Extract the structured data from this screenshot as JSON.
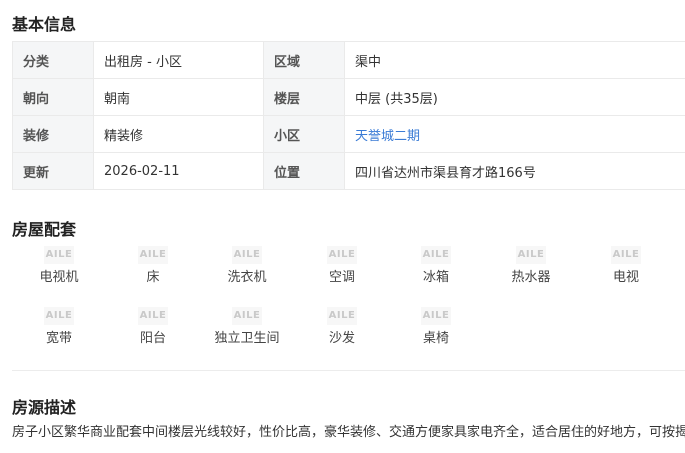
{
  "basic": {
    "title": "基本信息",
    "rows": [
      {
        "k1": "分类",
        "v1": "出租房 - 小区",
        "k2": "区域",
        "v2": "渠中"
      },
      {
        "k1": "朝向",
        "v1": "朝南",
        "k2": "楼层",
        "v2": "中层 (共35层)"
      },
      {
        "k1": "装修",
        "v1": "精装修",
        "k2": "小区",
        "v2": "天誉城二期"
      },
      {
        "k1": "更新",
        "v1": "2026-02-11",
        "k2": "位置",
        "v2": "四川省达州市渠县育才路166号"
      }
    ]
  },
  "facilities": {
    "title": "房屋配套",
    "icon_text": "AILE",
    "items": [
      {
        "label": "电视机",
        "icon": "tv-icon"
      },
      {
        "label": "床",
        "icon": "bed-icon"
      },
      {
        "label": "洗衣机",
        "icon": "washing-machine-icon"
      },
      {
        "label": "空调",
        "icon": "air-conditioner-icon"
      },
      {
        "label": "冰箱",
        "icon": "fridge-icon"
      },
      {
        "label": "热水器",
        "icon": "water-heater-icon"
      },
      {
        "label": "电视",
        "icon": "tv-icon"
      },
      {
        "label": "宽带",
        "icon": "broadband-icon"
      },
      {
        "label": "阳台",
        "icon": "balcony-icon"
      },
      {
        "label": "独立卫生间",
        "icon": "bathroom-icon"
      },
      {
        "label": "沙发",
        "icon": "sofa-icon"
      },
      {
        "label": "桌椅",
        "icon": "table-chair-icon"
      }
    ]
  },
  "description": {
    "title": "房源描述",
    "text": "房子小区繁华商业配套中间楼层光线较好，性价比高，豪华装修、交通方便家具家电齐全，适合居住的好地方，可按揭"
  },
  "colors": {
    "link": "#3a7bd5",
    "label_bg": "#f5f6f7",
    "border": "#eaeaea"
  }
}
